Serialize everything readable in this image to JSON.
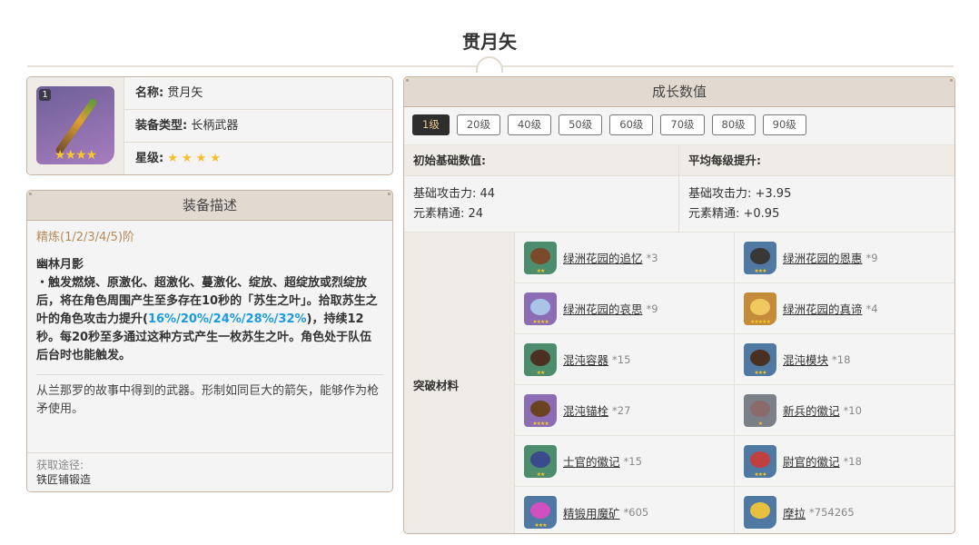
{
  "title": "贯月矢",
  "info": {
    "refine_badge": "1",
    "name_label": "名称:",
    "name": "贯月矢",
    "type_label": "装备类型:",
    "type": "长柄武器",
    "rarity_label": "星级:",
    "stars": "★★★★",
    "rarity": 4
  },
  "desc": {
    "header": "装备描述",
    "refine": "精炼(1/2/3/4/5)阶",
    "effect_title": "幽林月影",
    "effect_a": "・触发燃烧、原激化、超激化、蔓激化、绽放、超绽放或烈绽放后，将在角色周围产生至多存在10秒的「苏生之叶」。拾取苏生之叶的角色攻击力提升(",
    "effect_hl": "16%/20%/24%/28%/32%",
    "effect_b": ")，持续12秒。每20秒至多通过这种方式产生一枚苏生之叶。角色处于队伍后台时也能触发。",
    "lore": "从兰那罗的故事中得到的武器。形制如同巨大的箭矢，能够作为枪矛使用。",
    "source_label": "获取途径:",
    "source": "铁匠铺锻造"
  },
  "growth": {
    "header": "成长数值",
    "levels": [
      "1级",
      "20级",
      "40级",
      "50级",
      "60级",
      "70级",
      "80级",
      "90级"
    ],
    "base_label": "初始基础数值:",
    "avg_label": "平均每级提升:",
    "base": [
      "基础攻击力: 44",
      "元素精通: 24"
    ],
    "avg": [
      "基础攻击力: +3.95",
      "元素精通: +0.95"
    ],
    "mats_label": "突破材料",
    "materials": [
      {
        "name": "绿洲花园的追忆",
        "count": "*3",
        "bg": "#4d8c6c",
        "orb": "#7a4a2a",
        "stars": "★★"
      },
      {
        "name": "绿洲花园的恩惠",
        "count": "*9",
        "bg": "#4f78a2",
        "orb": "#3a3836",
        "stars": "★★★"
      },
      {
        "name": "绿洲花园的哀思",
        "count": "*9",
        "bg": "#8a6db5",
        "orb": "#a9c4e8",
        "stars": "★★★★"
      },
      {
        "name": "绿洲花园的真谛",
        "count": "*4",
        "bg": "#c48c3a",
        "orb": "#f0c860",
        "stars": "★★★★★"
      },
      {
        "name": "混沌容器",
        "count": "*15",
        "bg": "#4d8c6c",
        "orb": "#4a3020",
        "stars": "★★"
      },
      {
        "name": "混沌模块",
        "count": "*18",
        "bg": "#4f78a2",
        "orb": "#4a3020",
        "stars": "★★★"
      },
      {
        "name": "混沌锚栓",
        "count": "*27",
        "bg": "#8a6db5",
        "orb": "#6a4420",
        "stars": "★★★★"
      },
      {
        "name": "新兵的徽记",
        "count": "*10",
        "bg": "#7a7f88",
        "orb": "#8a6a6a",
        "stars": "★"
      },
      {
        "name": "士官的徽记",
        "count": "*15",
        "bg": "#4d8c6c",
        "orb": "#3a4a8a",
        "stars": "★★"
      },
      {
        "name": "尉官的徽记",
        "count": "*18",
        "bg": "#4f78a2",
        "orb": "#c04040",
        "stars": "★★★"
      },
      {
        "name": "精锻用魔矿",
        "count": "*605",
        "bg": "#4f78a2",
        "orb": "#d050c0",
        "stars": "★★★"
      },
      {
        "name": "摩拉",
        "count": "*754265",
        "bg": "#4f78a2",
        "orb": "#e8c040",
        "stars": ""
      }
    ]
  }
}
